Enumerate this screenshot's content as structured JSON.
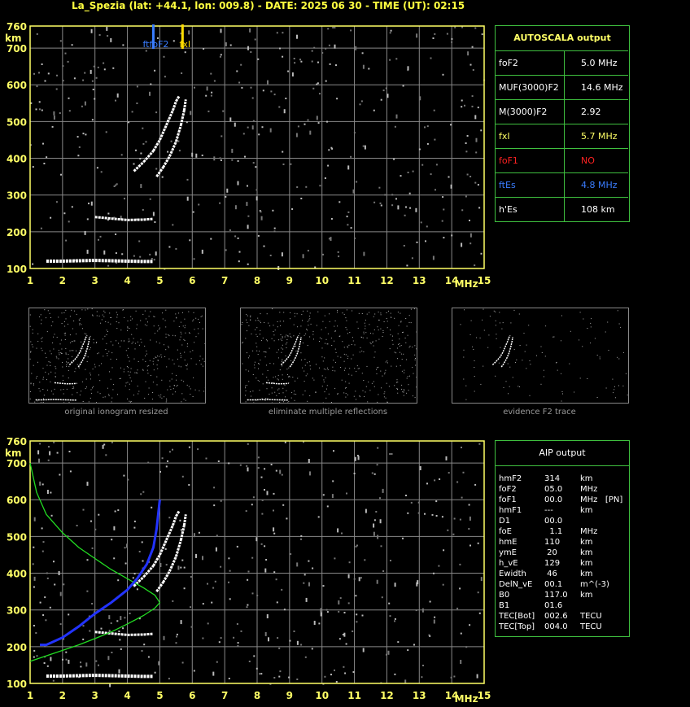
{
  "header": {
    "title": "La_Spezia (lat: +44.1, lon: 009.8) - DATE: 2025 06 30 - TIME (UT): 02:15"
  },
  "colors": {
    "axis": "#ffff66",
    "grid": "#888888",
    "trace": "#ffffff",
    "profile": "#22dd22",
    "fit": "#2233ff",
    "foF2_marker": "#3a7dff",
    "fxI_marker": "#ffdd00",
    "table_border": "#3fc03f"
  },
  "chart_data": [
    {
      "type": "scatter",
      "name": "main_ionogram",
      "xlabel": "MHz",
      "ylabel": "km",
      "xlim": [
        1,
        15
      ],
      "ylim": [
        100,
        760
      ],
      "xticks": [
        1,
        2,
        3,
        4,
        5,
        6,
        7,
        8,
        9,
        10,
        11,
        12,
        13,
        14,
        15
      ],
      "yticks": [
        100,
        200,
        300,
        400,
        500,
        600,
        700,
        760
      ],
      "grid": true,
      "markers": [
        {
          "label": "ftfoF2",
          "x": 4.8
        },
        {
          "label": "fxI",
          "x": 5.7
        }
      ],
      "traces": {
        "Es": {
          "x": [
            1.5,
            2,
            2.5,
            3,
            3.5,
            4,
            4.5,
            4.8
          ],
          "y": [
            120,
            120,
            121,
            122,
            121,
            120,
            119,
            119
          ]
        },
        "F2_o": {
          "x": [
            4.2,
            4.5,
            4.8,
            5.0,
            5.2,
            5.4,
            5.5,
            5.6
          ],
          "y": [
            365,
            390,
            420,
            450,
            490,
            530,
            555,
            570
          ]
        },
        "F2_x": {
          "x": [
            4.9,
            5.1,
            5.3,
            5.5,
            5.65,
            5.75,
            5.8
          ],
          "y": [
            350,
            375,
            405,
            445,
            490,
            530,
            560
          ]
        },
        "weak_F": {
          "x": [
            3.0,
            3.5,
            4.0,
            4.5,
            4.8
          ],
          "y": [
            240,
            236,
            232,
            233,
            235
          ]
        }
      }
    },
    {
      "type": "scatter",
      "name": "aip_ionogram",
      "xlabel": "MHz",
      "ylabel": "km",
      "xlim": [
        1,
        15
      ],
      "ylim": [
        100,
        760
      ],
      "xticks": [
        1,
        2,
        3,
        4,
        5,
        6,
        7,
        8,
        9,
        10,
        11,
        12,
        13,
        14,
        15
      ],
      "yticks": [
        100,
        200,
        300,
        400,
        500,
        600,
        700,
        760
      ],
      "grid": true,
      "profile_green": {
        "x": [
          1.0,
          1.5,
          2.0,
          2.5,
          3.0,
          3.5,
          4.0,
          4.5,
          4.85,
          5.0,
          4.85,
          4.5,
          4.0,
          3.5,
          3.0,
          2.5,
          2.0,
          1.5,
          1.2,
          1.0
        ],
        "y": [
          160,
          175,
          190,
          205,
          222,
          240,
          262,
          285,
          305,
          320,
          340,
          360,
          385,
          410,
          440,
          470,
          510,
          560,
          620,
          700
        ]
      },
      "profile_blue": {
        "x": [
          1.3,
          1.5,
          2.0,
          2.5,
          3.0,
          3.5,
          4.0,
          4.3,
          4.6,
          4.8,
          4.9,
          5.0
        ],
        "y": [
          205,
          205,
          225,
          255,
          290,
          320,
          355,
          385,
          425,
          470,
          520,
          600
        ]
      }
    }
  ],
  "autoscala": {
    "title": "AUTOSCALA output",
    "rows": [
      {
        "key": "foF2",
        "value": "5.0 MHz",
        "kcolor": "#ffffff",
        "vcolor": "#ffffff"
      },
      {
        "key": "MUF(3000)F2",
        "value": "14.6 MHz",
        "kcolor": "#ffffff",
        "vcolor": "#ffffff"
      },
      {
        "key": "M(3000)F2",
        "value": "2.92",
        "kcolor": "#ffffff",
        "vcolor": "#ffffff"
      },
      {
        "key": "fxI",
        "value": "5.7 MHz",
        "kcolor": "#ffff66",
        "vcolor": "#ffff66"
      },
      {
        "key": "foF1",
        "value": "NO",
        "kcolor": "#ff2222",
        "vcolor": "#ff2222"
      },
      {
        "key": "ftEs",
        "value": "4.8 MHz",
        "kcolor": "#3a7dff",
        "vcolor": "#3a7dff"
      },
      {
        "key": "h'Es",
        "value": "108     km",
        "kcolor": "#ffffff",
        "vcolor": "#ffffff"
      }
    ]
  },
  "thumbnails": [
    {
      "caption": "original ionogram resized"
    },
    {
      "caption": "eliminate multiple reflections"
    },
    {
      "caption": "evidence F2 trace"
    }
  ],
  "aip": {
    "title": "AIP output",
    "rows": [
      {
        "k": "hmF2",
        "v": "314",
        "u": "km"
      },
      {
        "k": "foF2",
        "v": "05.0",
        "u": "MHz"
      },
      {
        "k": "foF1",
        "v": "00.0",
        "u": "MHz   [PN]"
      },
      {
        "k": "hmF1",
        "v": "---",
        "u": "km"
      },
      {
        "k": "D1",
        "v": "00.0",
        "u": ""
      },
      {
        "k": "foE",
        "v": "  1.1",
        "u": "MHz"
      },
      {
        "k": "hmE",
        "v": "110",
        "u": "km"
      },
      {
        "k": "ymE",
        "v": " 20",
        "u": "km"
      },
      {
        "k": "h_vE",
        "v": "129",
        "u": "km"
      },
      {
        "k": "Ewidth",
        "v": " 46",
        "u": "km"
      },
      {
        "k": "DelN_vE",
        "v": "00.1",
        "u": "m^(-3)"
      },
      {
        "k": "B0",
        "v": "117.0",
        "u": "km"
      },
      {
        "k": "B1",
        "v": "01.6",
        "u": ""
      },
      {
        "k": "TEC[Bot]",
        "v": "002.6",
        "u": "TECU"
      },
      {
        "k": "TEC[Top]",
        "v": "004.0",
        "u": "TECU"
      }
    ]
  }
}
